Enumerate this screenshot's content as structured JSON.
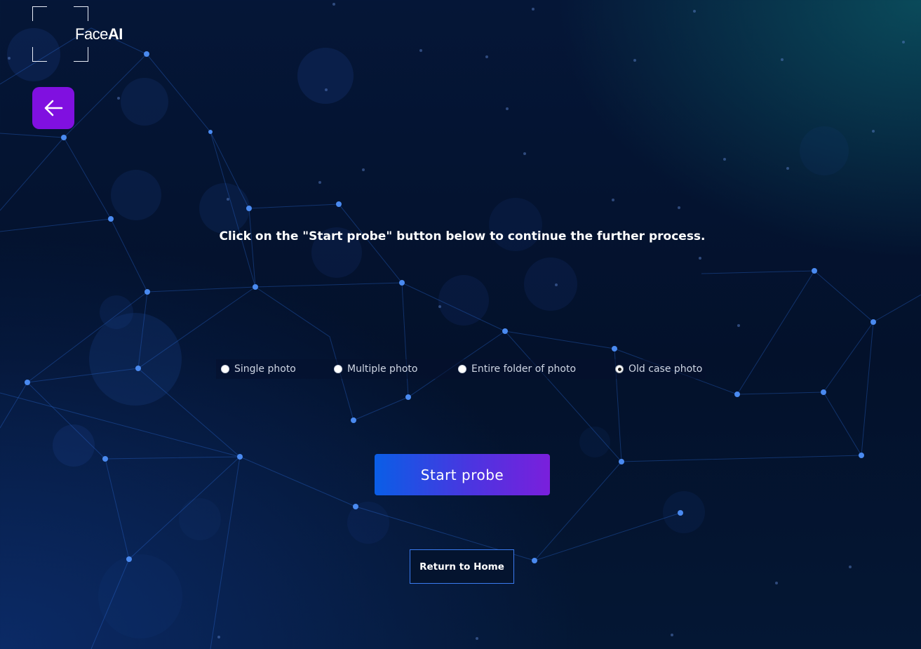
{
  "brand": {
    "name_part1": "Face",
    "name_part2": "AI"
  },
  "header": {
    "back_icon": "arrow-left-icon"
  },
  "main": {
    "instruction": "Click on the \"Start probe\" button below to continue the further process.",
    "options": [
      {
        "label": "Single photo",
        "checked": false
      },
      {
        "label": "Multiple photo",
        "checked": false
      },
      {
        "label": "Entire folder of photo",
        "checked": false
      },
      {
        "label": "Old case photo",
        "checked": true
      }
    ],
    "start_label": "Start probe",
    "home_label": "Return to Home"
  },
  "colors": {
    "accent_purple": "#8010e0",
    "button_gradient_start": "#0a5ee6",
    "button_gradient_end": "#7a1fdc",
    "outline_blue": "#3a7bf0",
    "background": "#03112b"
  }
}
